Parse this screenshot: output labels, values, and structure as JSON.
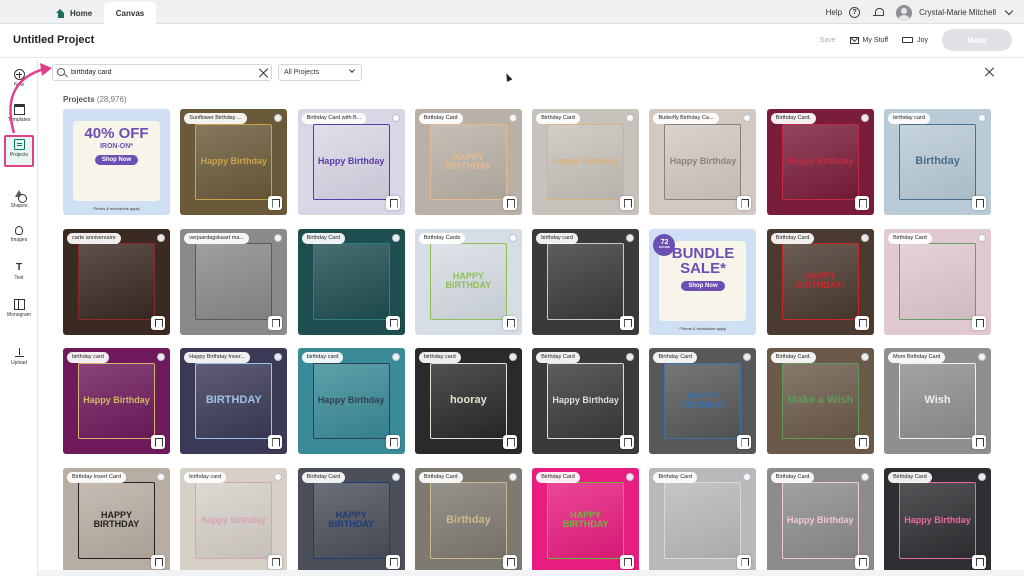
{
  "tabs": {
    "home": "Home",
    "canvas": "Canvas"
  },
  "top_right": {
    "help": "Help",
    "user": "Crystal-Marie Mitchell"
  },
  "header": {
    "title": "Untitled Project",
    "save": "Save",
    "my_stuff": "My Stuff",
    "machine": "Joy",
    "make": "Make"
  },
  "sidebar": {
    "items": [
      {
        "label": "New",
        "icon": "plus-circle-icon"
      },
      {
        "label": "Templates",
        "icon": "shirt-icon"
      },
      {
        "label": "Projects",
        "icon": "projects-icon"
      },
      {
        "label": "Shapes",
        "icon": "shapes-icon"
      },
      {
        "label": "Images",
        "icon": "lightbulb-icon"
      },
      {
        "label": "Text",
        "icon": "text-icon"
      },
      {
        "label": "Monogram",
        "icon": "monogram-icon"
      },
      {
        "label": "Upload",
        "icon": "upload-icon"
      }
    ]
  },
  "search": {
    "value": "birthday card",
    "filter": "All Projects"
  },
  "results": {
    "label": "Projects",
    "count": "(28,976)"
  },
  "promo_40": {
    "big": "40% OFF",
    "sub": "IRON-ON*",
    "button": "Shop Now",
    "terms": "*Terms & exclusions apply."
  },
  "promo_bundle": {
    "badge_num": "72",
    "badge_unit": "HOURS",
    "big": "BUNDLE SALE*",
    "button": "Shop Now",
    "terms": "*Terms & exclusions apply."
  },
  "cards": [
    {
      "title": "",
      "art": "",
      "bg": "#cfe0f4",
      "fg": "#6b4fb3",
      "type": "promo40"
    },
    {
      "title": "Sunflower Birthday ...",
      "art": "Happy Birthday",
      "bg": "#6b5a3a",
      "fg": "#c9a448"
    },
    {
      "title": "Birthday Card with B...",
      "art": "Happy Birthday",
      "bg": "#d9d7e6",
      "fg": "#5a3aa8"
    },
    {
      "title": "Birthday Card",
      "art": "HAPPY BIRTHDAY",
      "bg": "#b9b1a7",
      "fg": "#e6b98f"
    },
    {
      "title": "Birthday Card",
      "art": "Happy Birthday",
      "bg": "#c7c2bb",
      "fg": "#d8b27c"
    },
    {
      "title": "Butterfly Birthday Ca...",
      "art": "Happy Birthday",
      "bg": "#d2c9c2",
      "fg": "#8c7f79"
    },
    {
      "title": "Birthday Card.",
      "art": "Happy Birthday",
      "bg": "#7a1d3a",
      "fg": "#c02b46"
    },
    {
      "title": "birthday card",
      "art": "Birthday",
      "bg": "#b9cbd6",
      "fg": "#4a6f8c"
    },
    {
      "title": "carte anniversaire",
      "art": "",
      "bg": "#3a2a22",
      "fg": "#8b2a2a"
    },
    {
      "title": "verjaardagskaart ma...",
      "art": "",
      "bg": "#8a8a88",
      "fg": "#5a5a58"
    },
    {
      "title": "Birthday Card",
      "art": "",
      "bg": "#1f4e50",
      "fg": "#2f7f7f"
    },
    {
      "title": "Birthday Cards",
      "art": "HAPPY BIRTHDAY",
      "bg": "#d6dde4",
      "fg": "#8dbf55"
    },
    {
      "title": "birthday card",
      "art": "",
      "bg": "#3a3a3c",
      "fg": "#c9c9c9"
    },
    {
      "title": "",
      "art": "",
      "bg": "#cfe0f4",
      "fg": "#6b4fb3",
      "type": "promobundle"
    },
    {
      "title": "Birthday Card",
      "art": "HAPPY BIRTHDAY!",
      "bg": "#4a3a30",
      "fg": "#c8282c"
    },
    {
      "title": "Birthday Card",
      "art": "",
      "bg": "#e0c9cf",
      "fg": "#6a9a6a"
    },
    {
      "title": "birthday card",
      "art": "Happy Birthday",
      "bg": "#6e1a5c",
      "fg": "#d4b86a"
    },
    {
      "title": "Happy Birthday Inser...",
      "art": "BIRTHDAY",
      "bg": "#3b3a56",
      "fg": "#9fc2e8"
    },
    {
      "title": "birthday card",
      "art": "Happy Birthday",
      "bg": "#3a8b97",
      "fg": "#333f55"
    },
    {
      "title": "birthday card",
      "art": "hooray",
      "bg": "#2a2a2a",
      "fg": "#e6e0d0"
    },
    {
      "title": "Birthday Card",
      "art": "Happy Birthday",
      "bg": "#3a3a3a",
      "fg": "#dedede"
    },
    {
      "title": "Birthday Card",
      "art": "HAPPY BIRTHDAY",
      "bg": "#585858",
      "fg": "#3d6fa8"
    },
    {
      "title": "Birthday Card.",
      "art": "Make a Wish",
      "bg": "#6b5a4a",
      "fg": "#5f9a5a"
    },
    {
      "title": "Mom Birthday Card",
      "art": "Wish",
      "bg": "#8f8f8f",
      "fg": "#f0eeee"
    },
    {
      "title": "Birthday Insert Card",
      "art": "HAPPY BIRTHDAY",
      "bg": "#b8ada2",
      "fg": "#222222"
    },
    {
      "title": "birthday card",
      "art": "happy birthday",
      "bg": "#d6d0c8",
      "fg": "#d7a3b8"
    },
    {
      "title": "Birthday Card",
      "art": "HAPPY BIRTHDAY",
      "bg": "#4b4f5a",
      "fg": "#1e3c7a"
    },
    {
      "title": "Birthday Card",
      "art": "Birthday",
      "bg": "#7e7a72",
      "fg": "#c9b98c"
    },
    {
      "title": "Birthday Card",
      "art": "HAPPY BIRTHDAY",
      "bg": "#e71d7f",
      "fg": "#6ab83e"
    },
    {
      "title": "Birthday Card",
      "art": "",
      "bg": "#b9b9bb",
      "fg": "#d8d8d8"
    },
    {
      "title": "Birthday Card",
      "art": "Happy Birthday",
      "bg": "#8c8c8e",
      "fg": "#f1c8d4"
    },
    {
      "title": "Birthday Card",
      "art": "Happy Birthday",
      "bg": "#2f2f33",
      "fg": "#e86aa0"
    }
  ]
}
